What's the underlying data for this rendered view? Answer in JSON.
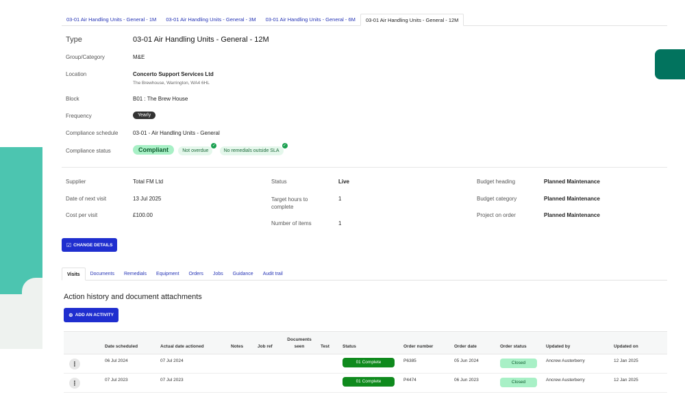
{
  "top_tabs": [
    {
      "label": "03-01 Air Handling Units - General - 1M",
      "active": false
    },
    {
      "label": "03-01 Air Handling Units - General - 3M",
      "active": false
    },
    {
      "label": "03-01 Air Handling Units - General - 6M",
      "active": false
    },
    {
      "label": "03-01 Air Handling Units - General - 12M",
      "active": true
    }
  ],
  "details": {
    "type_label": "Type",
    "type_value": "03-01 Air Handling Units - General - 12M",
    "group_label": "Group/Category",
    "group_value": "M&E",
    "location_label": "Location",
    "location_name": "Concerto Support Services Ltd",
    "location_address": "The Brewhouse, Warrington, WA4 6HL",
    "block_label": "Block",
    "block_value": "B01 : The Brew House",
    "frequency_label": "Frequency",
    "frequency_value": "Yearly",
    "schedule_label": "Compliance schedule",
    "schedule_value": "03-01 - Air Handling Units - General",
    "status_label": "Compliance status",
    "status_value": "Compliant",
    "status_badge_1": "Not overdue",
    "status_badge_2": "No remedials outside SLA"
  },
  "summary": {
    "supplier_label": "Supplier",
    "supplier_value": "Total FM Ltd",
    "next_visit_label": "Date of next visit",
    "next_visit_value": "13 Jul 2025",
    "cost_label": "Cost per visit",
    "cost_value": "£100.00",
    "status_label": "Status",
    "status_value": "Live",
    "target_label": "Target hours to complete",
    "target_value": "1",
    "items_label": "Number of items",
    "items_value": "1",
    "budget_heading_label": "Budget heading",
    "budget_heading_value": "Planned Maintenance",
    "budget_category_label": "Budget category",
    "budget_category_value": "Planned Maintenance",
    "project_label": "Project on order",
    "project_value": "Planned Maintenance"
  },
  "change_details_label": "CHANGE DETAILS",
  "section_tabs": [
    {
      "label": "Visits",
      "active": true
    },
    {
      "label": "Documents",
      "active": false
    },
    {
      "label": "Remedials",
      "active": false
    },
    {
      "label": "Equipment",
      "active": false
    },
    {
      "label": "Orders",
      "active": false
    },
    {
      "label": "Jobs",
      "active": false
    },
    {
      "label": "Guidance",
      "active": false
    },
    {
      "label": "Audit trail",
      "active": false
    }
  ],
  "section_title": "Action history and document attachments",
  "add_activity_label": "ADD AN ACTIVITY",
  "table": {
    "headers": {
      "date_scheduled": "Date scheduled",
      "actual_date": "Actual date actioned",
      "notes": "Notes",
      "job_ref": "Job ref",
      "documents_seen": "Documents seen",
      "test": "Test",
      "status": "Status",
      "order_number": "Order number",
      "order_date": "Order date",
      "order_status": "Order status",
      "updated_by": "Updated by",
      "updated_on": "Updated on"
    },
    "rows": [
      {
        "date_scheduled": "06 Jul 2024",
        "actual_date": "07 Jul 2024",
        "status": "01 Complete",
        "order_number": "P6385",
        "order_date": "05 Jun 2024",
        "order_status": "Closed",
        "updated_by": "Ancrew Austerberry",
        "updated_on": "12 Jan 2025"
      },
      {
        "date_scheduled": "07 Jul 2023",
        "actual_date": "07 Jul 2023",
        "status": "01 Complete",
        "order_number": "P4474",
        "order_date": "06 Jun 2023",
        "order_status": "Closed",
        "updated_by": "Ancrew Austerberry",
        "updated_on": "12 Jan 2025"
      }
    ]
  },
  "colors": {
    "accent_blue": "#1f2ecf",
    "teal_decor": "#4cc5b0",
    "dark_teal": "#02735e",
    "complete_green": "#0f8a1d",
    "compliant_green": "#a8f0c6"
  }
}
